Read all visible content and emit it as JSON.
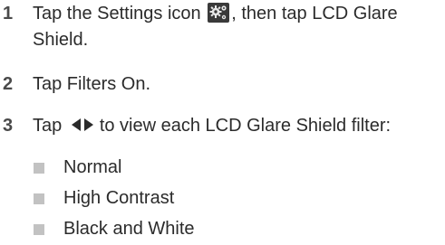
{
  "steps": [
    {
      "number": "1",
      "line1_before_icon": "Tap the Settings icon",
      "icon": "settings-gear-icon",
      "line1_after_icon": ", then tap LCD Glare",
      "line2": "Shield."
    },
    {
      "number": "2",
      "text": "Tap Filters On."
    },
    {
      "number": "3",
      "text_before_arrows": "Tap",
      "arrows_icon": "left-right-arrows-icon",
      "text_after_arrows": "to view each LCD Glare Shield filter:"
    }
  ],
  "filters": [
    "Normal",
    "High Contrast",
    "Black and White"
  ]
}
